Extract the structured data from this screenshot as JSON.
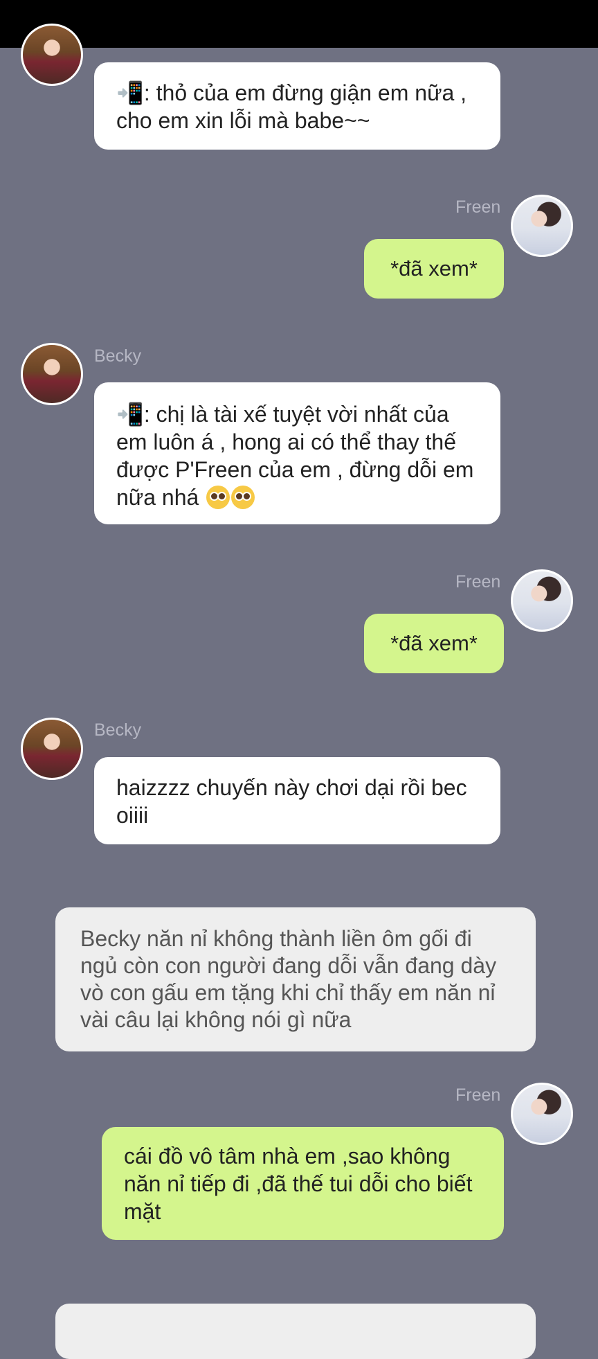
{
  "messages": [
    {
      "sender": "",
      "text": "📲: thỏ của em đừng giận em nữa , cho em xin lỗi mà babe~~"
    },
    {
      "sender": "Freen",
      "text": "*đã xem*"
    },
    {
      "sender": "Becky",
      "text_prefix": "📲: chị là tài xế tuyệt vời nhất của em luôn á , hong ai có thể thay thế được P'Freen của em , đừng dỗi em nữa nhá ",
      "emoji": "🥺🥺"
    },
    {
      "sender": "Freen",
      "text": "*đã xem*"
    },
    {
      "sender": "Becky",
      "text": "haizzzz chuyến này chơi dại rồi bec oiiii"
    },
    {
      "narration": "Becky năn nỉ không thành liền ôm gối đi ngủ còn con người đang dỗi vẫn đang dày vò con gấu em tặng khi chỉ thấy em năn nỉ vài câu lại không nói gì nữa"
    },
    {
      "sender": "Freen",
      "text": "cái đồ vô tâm nhà em ,sao không năn nỉ tiếp đi ,đã thế tui dỗi cho biết mặt"
    }
  ],
  "colors": {
    "background": "#6f7182",
    "sent_bubble": "#d4f58d",
    "received_bubble": "#ffffff",
    "narration_bubble": "#eeeeee",
    "status_bar": "#000000"
  }
}
